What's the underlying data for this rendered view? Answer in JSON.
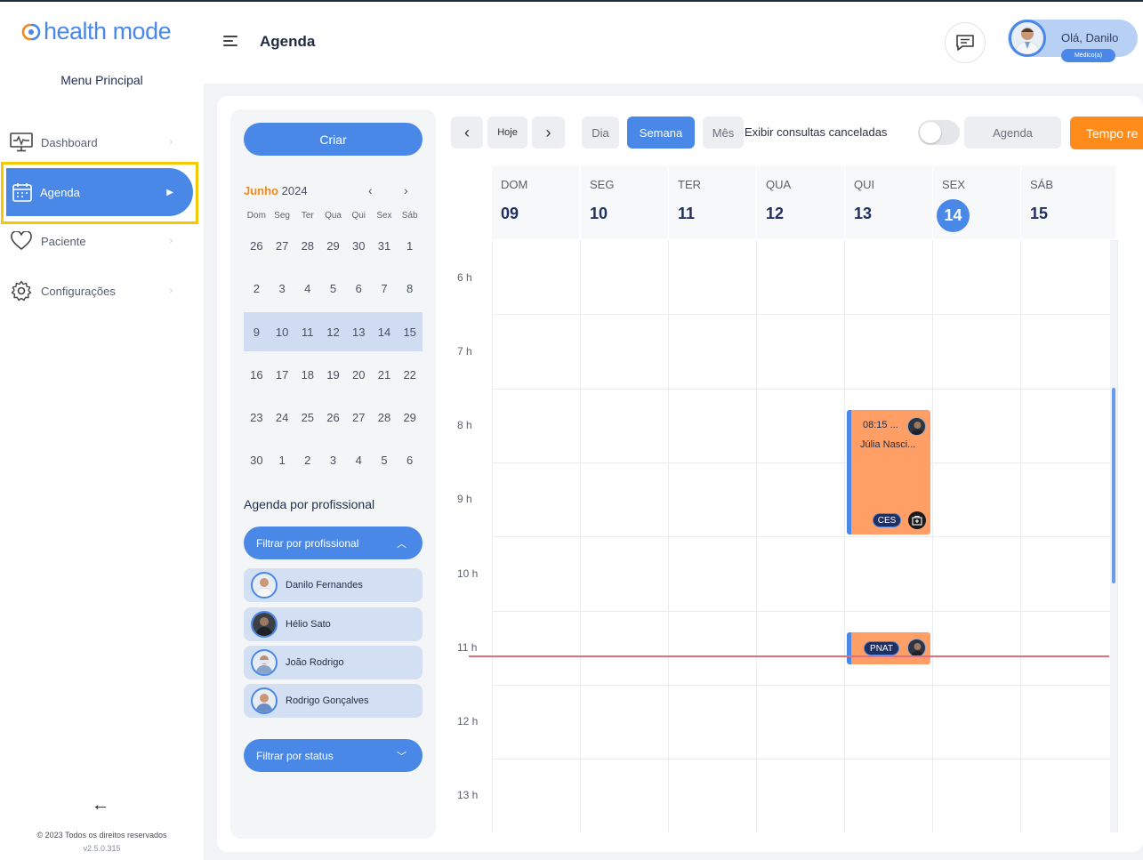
{
  "brand": {
    "name": "health mode"
  },
  "sidebar": {
    "menu_title": "Menu Principal",
    "items": [
      {
        "label": "Dashboard",
        "icon": "dashboard-monitor-icon"
      },
      {
        "label": "Agenda",
        "icon": "calendar-icon",
        "active": true
      },
      {
        "label": "Paciente",
        "icon": "heart-icon"
      },
      {
        "label": "Configurações",
        "icon": "gear-icon"
      }
    ],
    "copyright": "© 2023 Todos os direitos reservados",
    "version": "v2.5.0.315"
  },
  "header": {
    "title": "Agenda",
    "user_greeting": "Olá, Danilo",
    "user_role": "Médico(a)"
  },
  "left_panel": {
    "create_label": "Criar",
    "month": "Junho",
    "year": "2024",
    "weekdays": [
      "Dom",
      "Seg",
      "Ter",
      "Qua",
      "Qui",
      "Sex",
      "Sáb"
    ],
    "weeks": [
      [
        "26",
        "27",
        "28",
        "29",
        "30",
        "31",
        "1"
      ],
      [
        "2",
        "3",
        "4",
        "5",
        "6",
        "7",
        "8"
      ],
      [
        "9",
        "10",
        "11",
        "12",
        "13",
        "14",
        "15"
      ],
      [
        "16",
        "17",
        "18",
        "19",
        "20",
        "21",
        "22"
      ],
      [
        "23",
        "24",
        "25",
        "26",
        "27",
        "28",
        "29"
      ],
      [
        "30",
        "1",
        "2",
        "3",
        "4",
        "5",
        "6"
      ]
    ],
    "selected_week_index": 2,
    "prof_title": "Agenda por profissional",
    "filter_prof_label": "Filtrar por profissional",
    "professionals": [
      "Danilo Fernandes",
      "Hélio Sato",
      "João Rodrigo",
      "Rodrigo Gonçalves"
    ],
    "filter_status_label": "Filtrar por status"
  },
  "toolbar": {
    "today": "Hoje",
    "views": [
      "Dia",
      "Semana",
      "Mês"
    ],
    "active_view": "Semana",
    "show_cancelled_label": "Exibir consultas canceladas",
    "show_cancelled": false,
    "agenda_button": "Agenda",
    "orange_button": "Tempo re"
  },
  "calendar": {
    "days": [
      {
        "name": "DOM",
        "date": "09"
      },
      {
        "name": "SEG",
        "date": "10"
      },
      {
        "name": "TER",
        "date": "11"
      },
      {
        "name": "QUA",
        "date": "12"
      },
      {
        "name": "QUI",
        "date": "13"
      },
      {
        "name": "SEX",
        "date": "14",
        "today": true
      },
      {
        "name": "SÁB",
        "date": "15"
      }
    ],
    "hours": [
      "6 h",
      "7 h",
      "8 h",
      "9 h",
      "10 h",
      "11 h",
      "12 h",
      "13 h"
    ],
    "events": [
      {
        "time": "08:15 ...",
        "patient": "Júlia Nasci...",
        "badge": "CES"
      },
      {
        "badge": "PNAT"
      }
    ]
  },
  "colors": {
    "primary": "#4a88e8",
    "accent_orange": "#ff8c1a",
    "event": "#ff9f66",
    "highlight_border": "#f5c800",
    "now_line": "#e2707c"
  }
}
